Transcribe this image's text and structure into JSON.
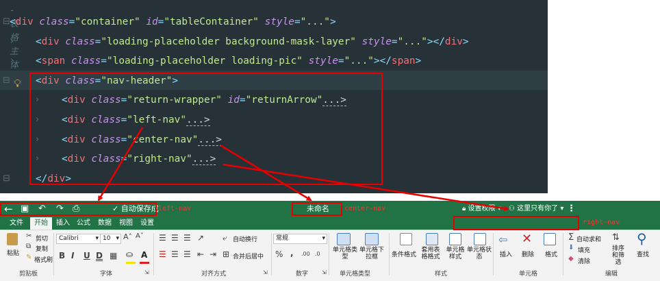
{
  "editor": {
    "comment_top": "<!-- 表格主体 -->",
    "lines": [
      {
        "tag": "div",
        "attrs": [
          {
            "n": "class",
            "v": "\"container\""
          },
          {
            "n": "id",
            "v": "\"tableContainer\""
          },
          {
            "n": "style",
            "v": "\"...\""
          }
        ],
        "suffix": ">",
        "end": "",
        "fold": "⊟"
      },
      {
        "tag": "div",
        "attrs": [
          {
            "n": "class",
            "v": "\"loading-placeholder background-mask-layer\""
          },
          {
            "n": "style",
            "v": "\"...\""
          }
        ],
        "suffix": "></",
        "end": "div",
        "fold": "›"
      },
      {
        "tag": "span",
        "attrs": [
          {
            "n": "class",
            "v": "\"loading-placeholder loading-pic\""
          },
          {
            "n": "style",
            "v": "\"...\""
          }
        ],
        "suffix": "></",
        "end": "span",
        "fold": "›"
      },
      {
        "tag": "div",
        "attrs": [
          {
            "n": "class",
            "v": "\"nav-header\""
          }
        ],
        "suffix": ">",
        "end": "",
        "fold": "⊟"
      },
      {
        "tag": "div",
        "attrs": [
          {
            "n": "class",
            "v": "\"return-wrapper\""
          },
          {
            "n": "id",
            "v": "\"returnArrow\""
          }
        ],
        "suffix": "",
        "end": "",
        "fold": "›",
        "ellipsis": "...>"
      },
      {
        "tag": "div",
        "attrs": [
          {
            "n": "class",
            "v": "\"left-nav\""
          }
        ],
        "suffix": "",
        "end": "",
        "fold": "›",
        "ellipsis": "...>"
      },
      {
        "tag": "div",
        "attrs": [
          {
            "n": "class",
            "v": "\"center-nav\""
          }
        ],
        "suffix": "",
        "end": "",
        "fold": "›",
        "ellipsis": "...>"
      },
      {
        "tag": "div",
        "attrs": [
          {
            "n": "class",
            "v": "\"right-nav\""
          }
        ],
        "suffix": "",
        "end": "",
        "fold": "›",
        "ellipsis": "...>"
      },
      {
        "tag": "",
        "attrs": [],
        "suffix": "",
        "end": "div",
        "fold": "⊟",
        "close": true
      }
    ]
  },
  "toolbar": {
    "back_icon": "arrow-left-icon",
    "autosave_label": "自动保存成",
    "filename": "未命名",
    "permission_label": "设置权限",
    "collab_label": "这里只有你了",
    "more_glyph": "⋮"
  },
  "tabs": [
    {
      "label": "文件",
      "active": false
    },
    {
      "label": "开始",
      "active": true
    },
    {
      "label": "插入",
      "active": false
    },
    {
      "label": "公式",
      "active": false
    },
    {
      "label": "数据",
      "active": false
    },
    {
      "label": "视图",
      "active": false
    },
    {
      "label": "设置",
      "active": false
    }
  ],
  "ribbon": {
    "clipboard": {
      "paste": "粘贴",
      "cut": "剪切",
      "copy": "复制",
      "format_painter": "格式刷",
      "group": "剪贴板"
    },
    "font": {
      "family": "Calibri",
      "size": "10",
      "bold": "B",
      "italic": "I",
      "underline": "U",
      "double_underline": "D",
      "group": "字体"
    },
    "align": {
      "wrap": "自动换行",
      "merge": "合并后居中",
      "group": "对齐方式"
    },
    "number": {
      "format": "常规",
      "percent": "%",
      "comma": ",",
      "inc_dec": ".00",
      "dec_dec": ".0",
      "group": "数字"
    },
    "cell_type": {
      "btn1": "单元格类型",
      "btn2": "单元格下拉框",
      "group": "单元格类型"
    },
    "styles": {
      "cond": "条件格式",
      "table": "套用表格格式",
      "cell": "单元格样式",
      "state": "单元格状态",
      "group": "样式"
    },
    "cells": {
      "insert": "插入",
      "delete": "删除",
      "format": "格式",
      "group": "单元格"
    },
    "edit": {
      "autosum": "自动求和",
      "fill": "填充",
      "clear": "清除",
      "sort": "排序和筛选",
      "find": "查找",
      "group": "编辑"
    }
  },
  "annotations": {
    "left": "left-nav",
    "center": "center-nav",
    "right": "right-nav"
  },
  "colors": {
    "excel_green": "#217346",
    "annotation_red": "#e60000"
  }
}
